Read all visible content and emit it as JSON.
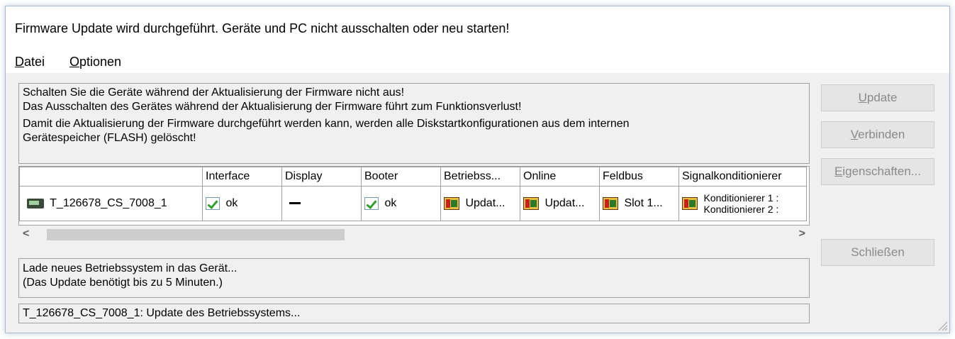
{
  "window": {
    "title": "Firmware Update wird durchgeführt. Geräte und PC nicht ausschalten oder neu starten!"
  },
  "menu": [
    {
      "mnemonic": "D",
      "rest": "atei"
    },
    {
      "mnemonic": "O",
      "rest": "ptionen"
    }
  ],
  "warning": {
    "line1": "Schalten Sie die Geräte während der Aktualisierung der Firmware nicht aus!",
    "line2": "Das Ausschalten des Gerätes während der Aktualisierung der Firmware führt zum Funktionsverlust!",
    "line3": "Damit die Aktualisierung der Firmware durchgeführt werden kann, werden alle Diskstartkonfigurationen aus dem internen",
    "line4": "Gerätespeicher (FLASH) gelöscht!"
  },
  "table": {
    "headers": [
      "",
      "Interface",
      "Display",
      "Booter",
      "Betriebss...",
      "Online",
      "Feldbus",
      "Signalkonditionierer"
    ],
    "row": {
      "device": "T_126678_CS_7008_1",
      "device_icon": "device-icon",
      "interface": "ok",
      "display": "—",
      "booter": "ok",
      "betriebssystem": "Updat...",
      "online": "Updat...",
      "feldbus": "Slot 1...",
      "signal_line1": "Konditionierer 1 :",
      "signal_line2": "Konditionierer 2 :"
    }
  },
  "scroll": {
    "left": "<",
    "right": ">"
  },
  "status": {
    "line1": "Lade neues Betriebssystem in das Gerät...",
    "line2": "(Das Update benötigt bis zu 5 Minuten.)"
  },
  "progress_text": "T_126678_CS_7008_1: Update des Betriebssystems...",
  "buttons": {
    "update": {
      "mnemonic": "U",
      "rest": "pdate"
    },
    "verbinden": {
      "mnemonic": "V",
      "rest": "erbinden"
    },
    "eigenschaften": {
      "mnemonic": "E",
      "rest": "igenschaften..."
    },
    "schliessen": "Schließen"
  },
  "colors": {
    "ok_check": "#2fa02f",
    "disabled_text": "#8a8a8a",
    "window_border": "#a9b8cc"
  }
}
